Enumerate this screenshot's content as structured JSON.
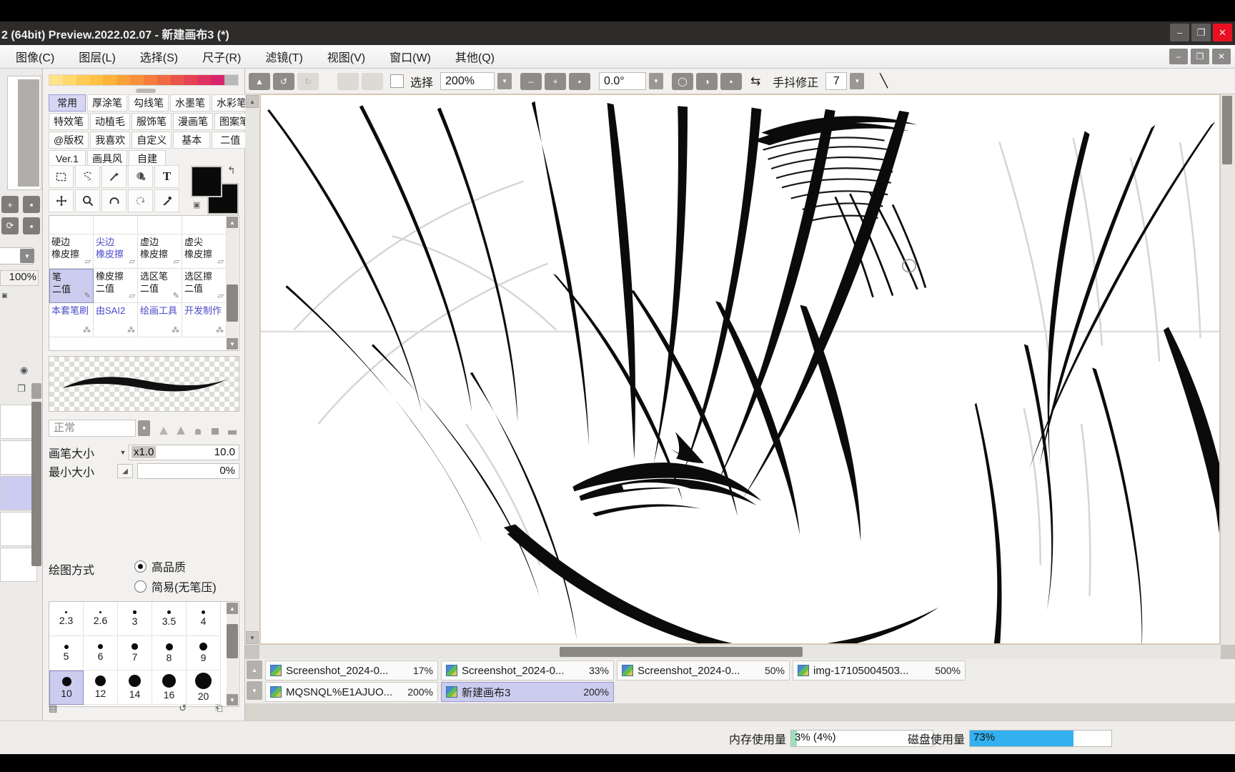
{
  "window": {
    "title": "2 (64bit) Preview.2022.02.07 - 新建画布3 (*)",
    "minimize": "–",
    "restore": "❐",
    "close": "✕"
  },
  "inner_window": {
    "minimize": "–",
    "restore": "❐",
    "close": "✕"
  },
  "menubar": {
    "items": [
      {
        "label": "图像(C)"
      },
      {
        "label": "图层(L)"
      },
      {
        "label": "选择(S)"
      },
      {
        "label": "尺子(R)"
      },
      {
        "label": "滤镜(T)"
      },
      {
        "label": "视图(V)"
      },
      {
        "label": "窗口(W)"
      },
      {
        "label": "其他(Q)"
      }
    ]
  },
  "left_sliver": {
    "zoom_value": "100%"
  },
  "brush_panel": {
    "categories_rows": [
      [
        {
          "label": "常用",
          "active": true
        },
        {
          "label": "厚涂笔",
          "active": false
        },
        {
          "label": "勾线笔",
          "active": false
        },
        {
          "label": "水墨笔",
          "active": false
        },
        {
          "label": "水彩笔",
          "active": false
        }
      ],
      [
        {
          "label": "特效笔",
          "active": false
        },
        {
          "label": "动植毛",
          "active": false
        },
        {
          "label": "服饰笔",
          "active": false
        },
        {
          "label": "漫画笔",
          "active": false
        },
        {
          "label": "图案笔",
          "active": false
        }
      ],
      [
        {
          "label": "@版权",
          "active": false
        },
        {
          "label": "我喜欢",
          "active": false
        },
        {
          "label": "自定义",
          "active": false
        },
        {
          "label": "基本",
          "active": false
        },
        {
          "label": "二值",
          "active": false
        }
      ],
      [
        {
          "label": "Ver.1",
          "active": false
        },
        {
          "label": "画具风",
          "active": false
        },
        {
          "label": "自建",
          "active": false
        }
      ]
    ],
    "tools_row1": [
      {
        "icon": "rect-select-icon",
        "glyph": "▭"
      },
      {
        "icon": "lasso-select-icon",
        "glyph": "⊂"
      },
      {
        "icon": "magic-wand-icon",
        "glyph": "✦"
      },
      {
        "icon": "bucket-fill-icon",
        "glyph": "◕"
      },
      {
        "icon": "text-tool-icon",
        "glyph": "T"
      }
    ],
    "tools_row2": [
      {
        "icon": "move-tool-icon",
        "glyph": "✥"
      },
      {
        "icon": "zoom-tool-icon",
        "glyph": "⌕"
      },
      {
        "icon": "rotate-tool-icon",
        "glyph": "∩"
      },
      {
        "icon": "undo-history-icon",
        "glyph": "↺"
      },
      {
        "icon": "eyedropper-icon",
        "glyph": "✒"
      }
    ],
    "color_main": "#0a0a0a",
    "color_sub": "#0a0a0a",
    "presets": [
      [
        {
          "l1": "硬边",
          "l2": "橡皮擦",
          "blue": false,
          "selected": false,
          "gi": "eraser-icon"
        },
        {
          "l1": "尖边",
          "l2": "橡皮擦",
          "blue": true,
          "selected": false,
          "gi": "eraser-icon"
        },
        {
          "l1": "虚边",
          "l2": "橡皮擦",
          "blue": false,
          "selected": false,
          "gi": "eraser-icon"
        },
        {
          "l1": "虚尖",
          "l2": "橡皮擦",
          "blue": false,
          "selected": false,
          "gi": "eraser-icon"
        }
      ],
      [
        {
          "l1": "笔",
          "l2": "二值",
          "blue": false,
          "selected": true,
          "gi": "pen-icon"
        },
        {
          "l1": "橡皮擦",
          "l2": "二值",
          "blue": false,
          "selected": false,
          "gi": "eraser-icon"
        },
        {
          "l1": "选区笔",
          "l2": "二值",
          "blue": false,
          "selected": false,
          "gi": "select-pen-icon"
        },
        {
          "l1": "选区擦",
          "l2": "二值",
          "blue": false,
          "selected": false,
          "gi": "select-eraser-icon"
        }
      ],
      [
        {
          "l1": "本套笔刷",
          "l2": "",
          "blue": true,
          "selected": false,
          "gi": "node-icon"
        },
        {
          "l1": "由SAI2",
          "l2": "",
          "blue": true,
          "selected": false,
          "gi": "node-icon"
        },
        {
          "l1": "绘画工具",
          "l2": "",
          "blue": true,
          "selected": false,
          "gi": "node-icon"
        },
        {
          "l1": "开发制作",
          "l2": "",
          "blue": true,
          "selected": false,
          "gi": "node-icon"
        }
      ]
    ],
    "blend_mode": "正常",
    "brush_size_label": "画笔大小",
    "brush_size_mult": "x1.0",
    "brush_size_value": "10.0",
    "min_size_label": "最小大小",
    "min_size_value": "0%",
    "draw_mode_label": "绘图方式",
    "draw_mode_options": [
      {
        "label": "高品质",
        "selected": true
      },
      {
        "label": "简易(无笔压)",
        "selected": false
      }
    ],
    "size_grid": [
      [
        {
          "value": "2.3",
          "dot": 3
        },
        {
          "value": "2.6",
          "dot": 3.5
        },
        {
          "value": "3",
          "dot": 4.5
        },
        {
          "value": "3.5",
          "dot": 5
        },
        {
          "value": "4",
          "dot": 5.5
        }
      ],
      [
        {
          "value": "5",
          "dot": 6
        },
        {
          "value": "6",
          "dot": 7.5
        },
        {
          "value": "7",
          "dot": 8.5
        },
        {
          "value": "8",
          "dot": 10
        },
        {
          "value": "9",
          "dot": 11.5
        }
      ],
      [
        {
          "value": "10",
          "dot": 13,
          "selected": true
        },
        {
          "value": "12",
          "dot": 15
        },
        {
          "value": "14",
          "dot": 17
        },
        {
          "value": "16",
          "dot": 19.5
        },
        {
          "value": "20",
          "dot": 23
        }
      ]
    ]
  },
  "canvas_toolbar": {
    "select_checkbox_label": "选择",
    "zoom_value": "200%",
    "minus": "–",
    "plus": "+",
    "reset": "▪",
    "rotation_value": "0.0°",
    "stabilizer_label": "手抖修正",
    "stabilizer_value": "7",
    "swap_icon": "⇆",
    "line_icon": "╲"
  },
  "document_tabs": {
    "row1": [
      {
        "name": "Screenshot_2024-0...",
        "zoom": "17%",
        "active": false
      },
      {
        "name": "Screenshot_2024-0...",
        "zoom": "33%",
        "active": false
      },
      {
        "name": "Screenshot_2024-0...",
        "zoom": "50%",
        "active": false
      },
      {
        "name": "img-17105004503...",
        "zoom": "500%",
        "active": false
      }
    ],
    "row2": [
      {
        "name": "MQSNQL%E1AJUO...",
        "zoom": "200%",
        "active": false
      },
      {
        "name": "新建画布3",
        "zoom": "200%",
        "active": true
      }
    ]
  },
  "statusbar": {
    "memory_label": "内存使用量",
    "memory_value": "3% (4%)",
    "memory_percent": 4,
    "memory_color": "#9ae0bd",
    "disk_label": "磁盘使用量",
    "disk_value": "73%",
    "disk_percent": 73,
    "disk_color": "#33b0ef"
  },
  "palette_colors": [
    "#ffe28a",
    "#ffd86e",
    "#ffcb55",
    "#ffc043",
    "#fdb239",
    "#fba13a",
    "#f9903c",
    "#f67c3e",
    "#f06a43",
    "#ea5347",
    "#e54253",
    "#e0325f",
    "#d8246d",
    "#b9b9b9"
  ]
}
